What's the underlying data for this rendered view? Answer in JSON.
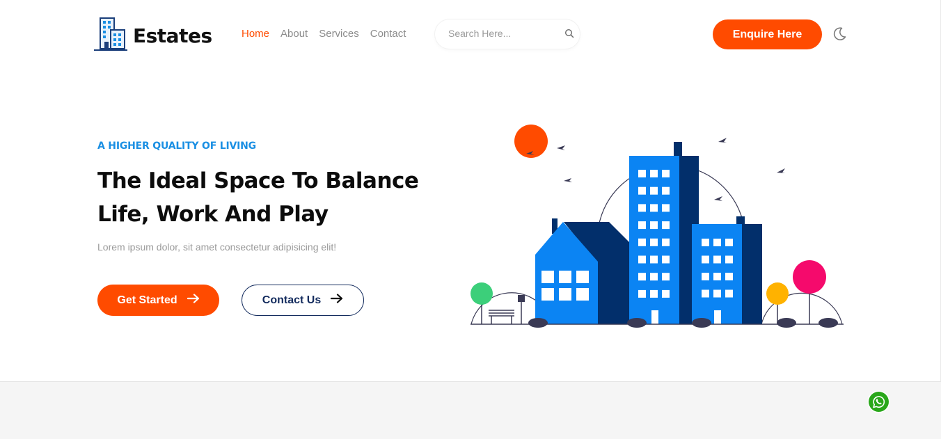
{
  "brand": {
    "name": "Estates",
    "logo_icon": "buildings-icon"
  },
  "nav": {
    "items": [
      {
        "label": "Home",
        "active": true
      },
      {
        "label": "About",
        "active": false
      },
      {
        "label": "Services",
        "active": false
      },
      {
        "label": "Contact",
        "active": false
      }
    ]
  },
  "search": {
    "placeholder": "Search Here...",
    "value": "",
    "icon": "search-icon"
  },
  "header": {
    "cta_label": "Enquire Here",
    "theme_toggle_icon": "moon-icon"
  },
  "hero": {
    "eyebrow": "A HIGHER QUALITY OF LIVING",
    "title": "The Ideal Space To Balance Life, Work And Play",
    "description": "Lorem ipsum dolor, sit amet consectetur adipisicing elit!",
    "primary_button": {
      "label": "Get Started",
      "icon": "arrow-right-icon"
    },
    "secondary_button": {
      "label": "Contact Us",
      "icon": "arrow-right-icon"
    },
    "illustration": "city-buildings-illustration"
  },
  "floating": {
    "whatsapp_icon": "whatsapp-icon"
  },
  "colors": {
    "accent": "#ff4b00",
    "primary_blue": "#1a8fe3",
    "navy": "#142c5e",
    "building_blue": "#0b84f3",
    "building_dark": "#022f6b",
    "whatsapp": "#29a71a"
  }
}
